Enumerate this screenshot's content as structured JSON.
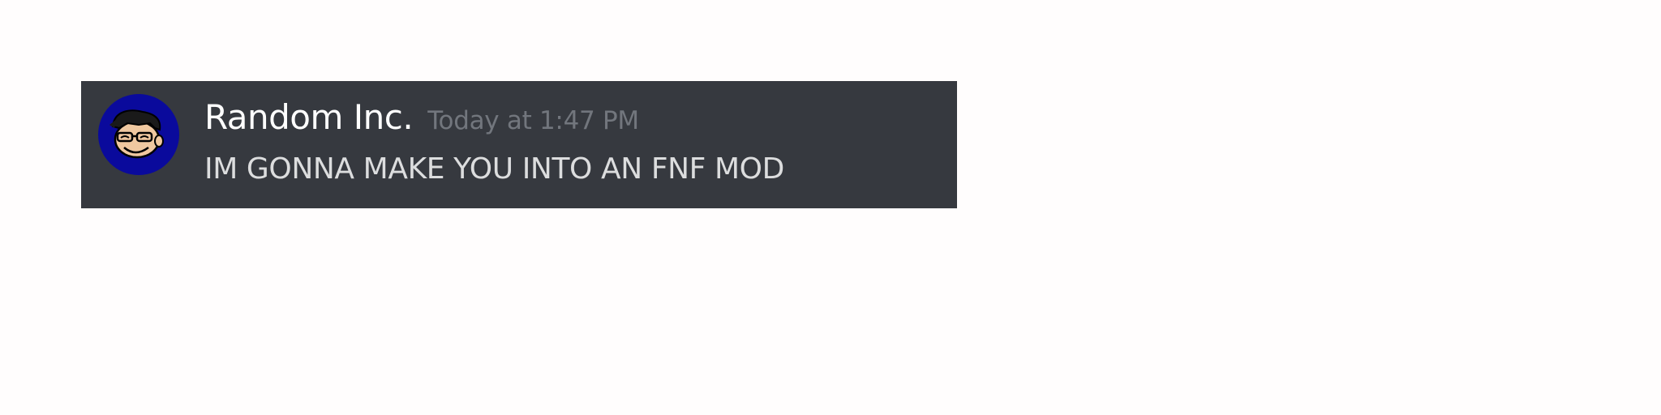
{
  "message": {
    "username": "Random Inc.",
    "timestamp": "Today at 1:47 PM",
    "content": "IM GONNA MAKE YOU INTO AN FNF MOD",
    "avatar_icon": "cartoon-face-avatar-icon"
  },
  "colors": {
    "background": "#fffdfd",
    "card": "#36393f",
    "username": "#ffffff",
    "timestamp": "#72767d",
    "content": "#dcddde",
    "avatar_bg": "#0a0a9c"
  }
}
